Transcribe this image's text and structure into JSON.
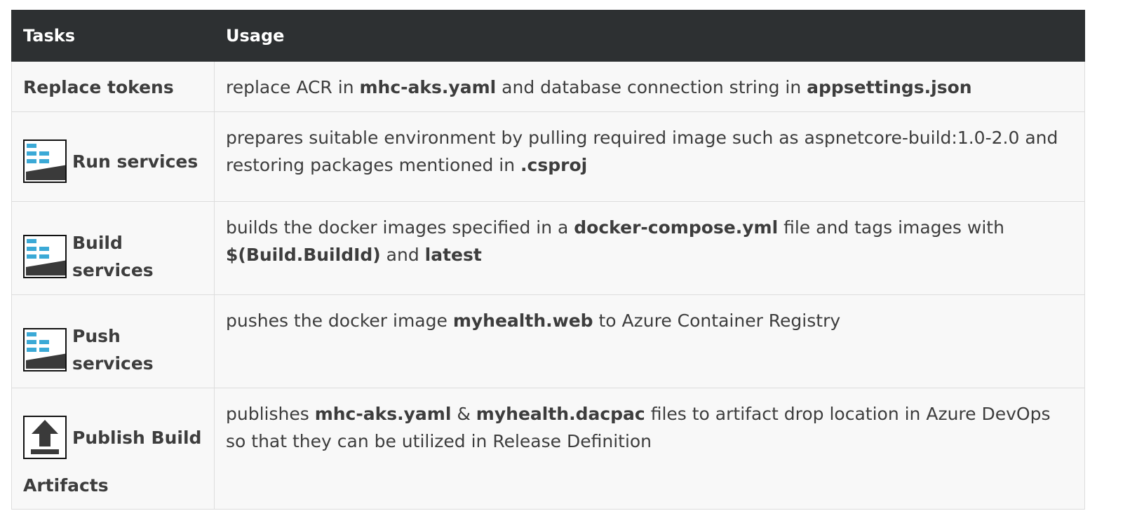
{
  "table": {
    "headers": {
      "tasks": "Tasks",
      "usage": "Usage"
    },
    "rows": [
      {
        "task": "Replace tokens",
        "icon": null,
        "usage": [
          {
            "t": "replace ACR in ",
            "b": false
          },
          {
            "t": "mhc-aks.yaml",
            "b": true
          },
          {
            "t": " and database connection string in ",
            "b": false
          },
          {
            "t": "appsettings.json",
            "b": true
          }
        ]
      },
      {
        "task": "Run services",
        "icon": "docker-compose-icon",
        "usage": [
          {
            "t": "prepares suitable environment by pulling required image such as aspnetcore-build:1.0-2.0 and restoring packages mentioned in ",
            "b": false
          },
          {
            "t": ".csproj",
            "b": true
          }
        ]
      },
      {
        "task": "Build services",
        "icon": "docker-compose-icon",
        "usage": [
          {
            "t": "builds the docker images specified in a ",
            "b": false
          },
          {
            "t": "docker-compose.yml",
            "b": true
          },
          {
            "t": " file and tags images with ",
            "b": false
          },
          {
            "t": "$(Build.BuildId)",
            "b": true
          },
          {
            "t": " and ",
            "b": false
          },
          {
            "t": "latest",
            "b": true
          }
        ]
      },
      {
        "task": "Push services",
        "icon": "docker-compose-icon",
        "usage": [
          {
            "t": "pushes the docker image ",
            "b": false
          },
          {
            "t": "myhealth.web",
            "b": true
          },
          {
            "t": " to Azure Container Registry",
            "b": false
          }
        ]
      },
      {
        "task_line1": "Publish Build",
        "task_line2": "Artifacts",
        "icon": "upload-arrow-icon",
        "usage": [
          {
            "t": "publishes ",
            "b": false
          },
          {
            "t": "mhc-aks.yaml",
            "b": true
          },
          {
            "t": " & ",
            "b": false
          },
          {
            "t": "myhealth.dacpac",
            "b": true
          },
          {
            "t": " files to artifact drop location in Azure DevOps so that they can be utilized in Release Definition",
            "b": false
          }
        ]
      }
    ]
  },
  "colors": {
    "header_bg": "#2d3032",
    "row_bg": "#f8f8f8",
    "text": "#3d3d3d",
    "docker_blue": "#3ba9d6",
    "icon_dark": "#3a3a3a"
  }
}
